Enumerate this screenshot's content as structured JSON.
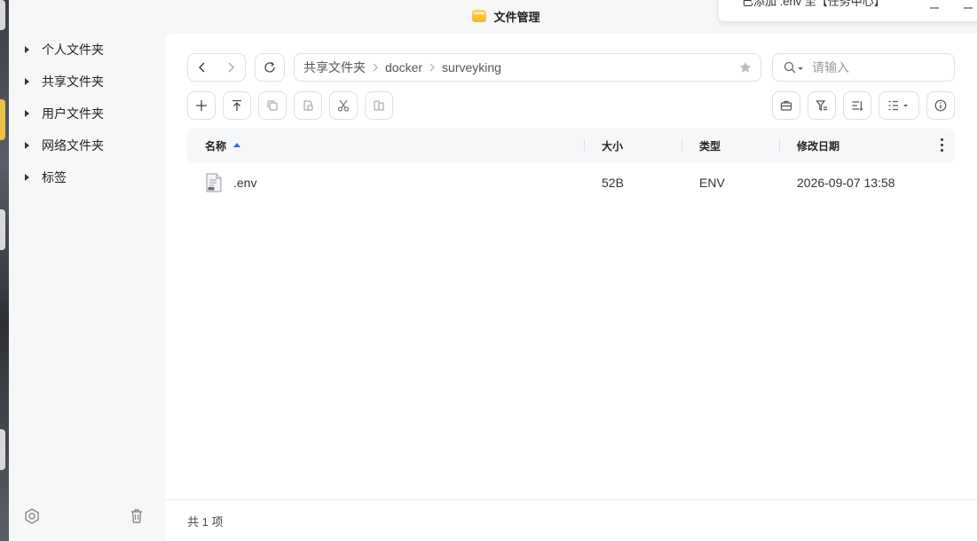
{
  "window": {
    "title": "文件管理"
  },
  "toast": {
    "message": "已添加 .env 至【任务中心】"
  },
  "sidebar": {
    "items": [
      {
        "label": "个人文件夹"
      },
      {
        "label": "共享文件夹"
      },
      {
        "label": "用户文件夹"
      },
      {
        "label": "网络文件夹"
      },
      {
        "label": "标签"
      }
    ]
  },
  "breadcrumb": [
    "共享文件夹",
    "docker",
    "surveyking"
  ],
  "search": {
    "placeholder": "请输入"
  },
  "table": {
    "columns": {
      "name": "名称",
      "size": "大小",
      "type": "类型",
      "modified": "修改日期"
    },
    "sort": {
      "column": "name",
      "direction": "ascending"
    },
    "rows": [
      {
        "name": ".env",
        "size": "52B",
        "type": "ENV",
        "modified": "2026-09-07 13:58"
      }
    ]
  },
  "status": {
    "count_text": "共 1 项"
  },
  "colors": {
    "accent": "#2f6fdf",
    "border": "#dcdfe4",
    "folder_icon": "#f3b81f"
  },
  "icons": {
    "nav": [
      "chevron-left-icon",
      "chevron-right-icon",
      "refresh-icon",
      "star-icon",
      "search-icon"
    ],
    "toolbar_left": [
      "plus-icon",
      "upload-icon",
      "copy-icon",
      "paste-icon",
      "cut-icon",
      "move-icon"
    ],
    "toolbar_right": [
      "archive-icon",
      "filter-icon",
      "sort-icon",
      "list-view-icon",
      "info-icon"
    ],
    "sidebar_footer": [
      "settings-icon",
      "trash-icon"
    ]
  }
}
